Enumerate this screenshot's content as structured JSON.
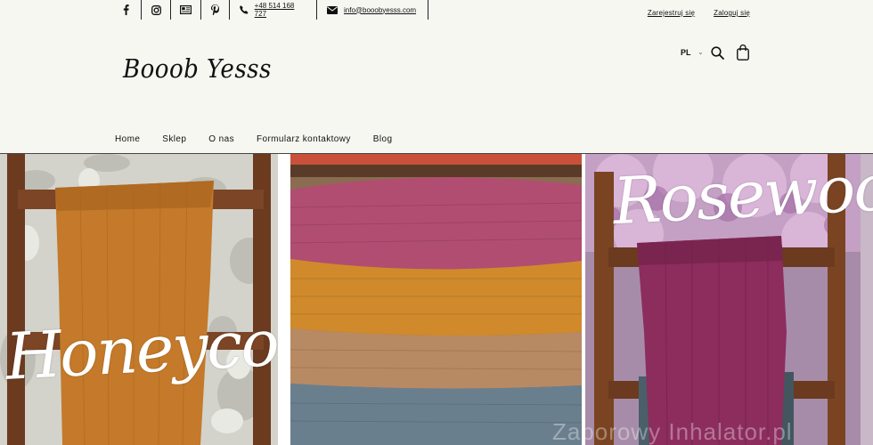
{
  "topbar": {
    "phone": "+48 514 168 727",
    "email": "info@booobyesss.com",
    "register": "Zarejestruj się",
    "login": "Zaloguj się"
  },
  "logo": {
    "text": "Booob Yesss"
  },
  "tools": {
    "language": "PL"
  },
  "nav": {
    "items": [
      "Home",
      "Sklep",
      "O nas",
      "Formularz kontaktowy",
      "Blog"
    ]
  },
  "hero": {
    "left_title": "Honeycomb",
    "right_title": "Rosewood",
    "watermark": "Zaporowy Inhalator.pl"
  },
  "colors": {
    "background": "#f7f7f2",
    "honeycomb": "#c47a2a",
    "rosewood": "#8c2d5e",
    "ladder": "#6b3a1f"
  }
}
